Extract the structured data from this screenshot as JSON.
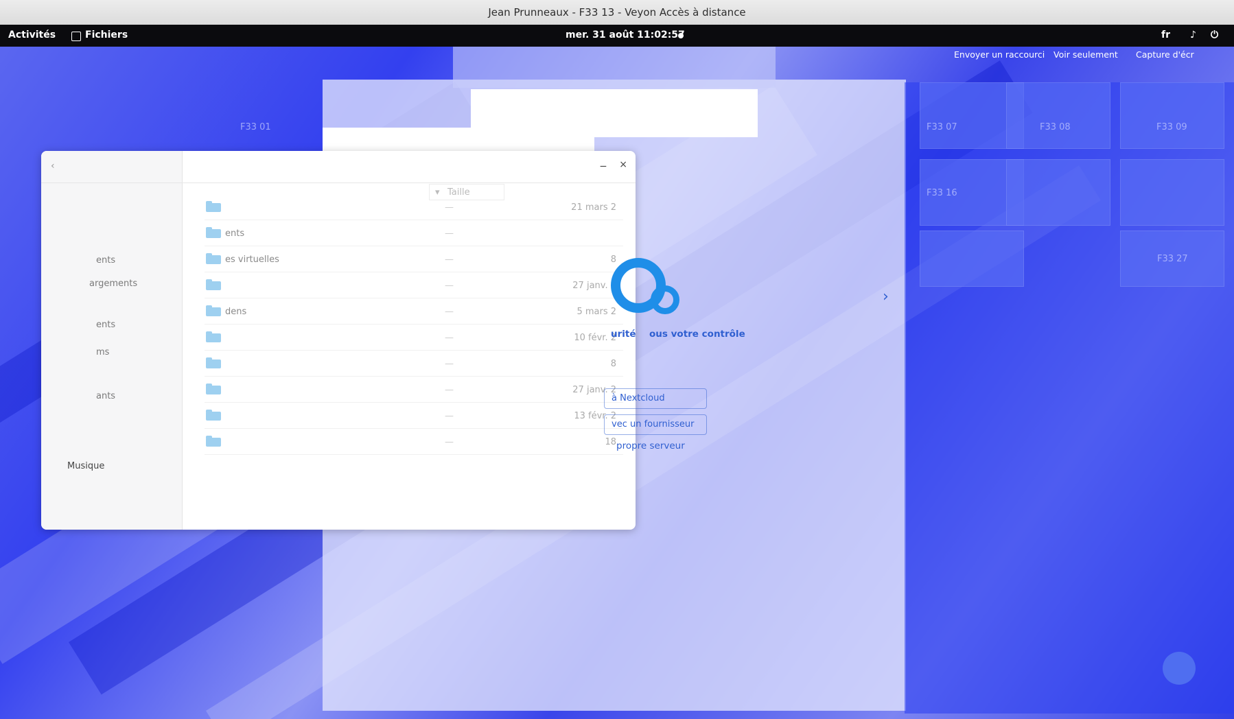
{
  "window": {
    "title": "Jean Prunneaux - F33 13 - Veyon Accès à distance"
  },
  "topbar": {
    "activities": "Activités",
    "app_menu": "Fichiers",
    "clock": "mer. 31 août  11:02:57",
    "keyboard_layout": "fr",
    "volume_icon": "volume-icon",
    "power_icon": "power-icon"
  },
  "veyon_toolbar": {
    "send_shortcut": "Envoyer un raccourci",
    "view_only": "Voir seulement",
    "screenshot": "Capture d'écr"
  },
  "computers": [
    "F33 01",
    "F33 07",
    "F33 08",
    "F33 09",
    "F33 16",
    "F33 27"
  ],
  "files_window": {
    "sort_label": "Taille",
    "sidebar": [
      "ents",
      "argements",
      "ents",
      "ms",
      "ants",
      "Musique"
    ],
    "rows": [
      {
        "name": "",
        "date": "21 mars 2"
      },
      {
        "name": "ents",
        "date": ""
      },
      {
        "name": "es virtuelles",
        "date": "8"
      },
      {
        "name": "",
        "date": "27 janv. 2"
      },
      {
        "name": "dens",
        "date": "5 mars 2"
      },
      {
        "name": "",
        "date": "10 févr. 2"
      },
      {
        "name": "",
        "date": "8"
      },
      {
        "name": "",
        "date": "27 janv. 2"
      },
      {
        "name": "",
        "date": "13 févr. 2"
      },
      {
        "name": "",
        "date": "18"
      }
    ]
  },
  "nextcloud": {
    "tagline_a": "urité",
    "tagline_b": "ous votre contrôle",
    "btn_login": "à Nextcloud",
    "btn_provider": "vec un fournisseur",
    "btn_server": "propre serveur"
  }
}
